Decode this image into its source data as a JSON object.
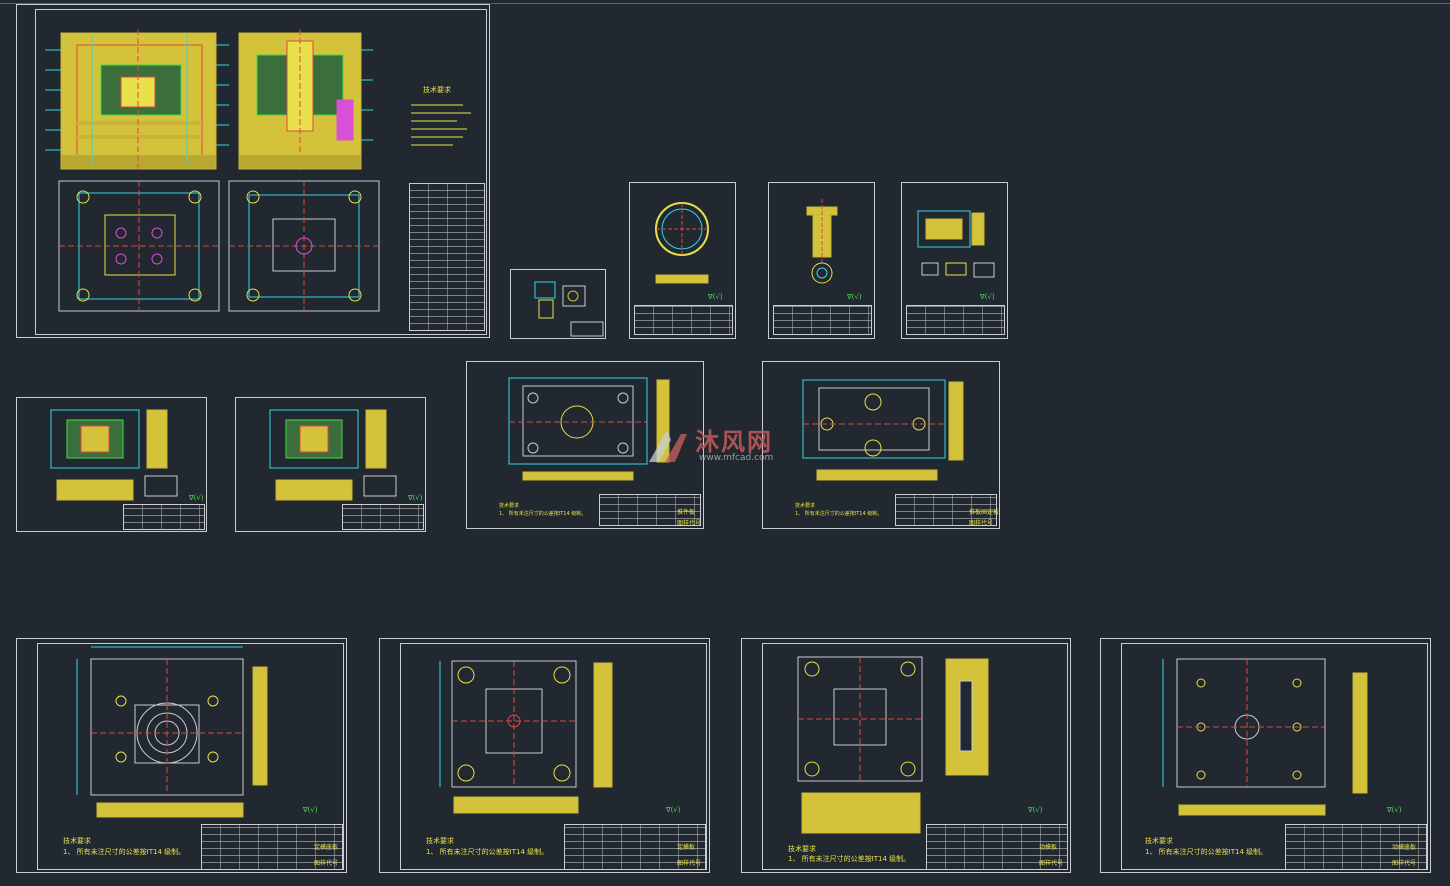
{
  "watermark": {
    "name_cn": "沐风网",
    "url": "www.mfcad.com"
  },
  "assembly_notes_title": "技术要求",
  "plate_notes": {
    "title": "技术要求",
    "line1": "1、 所有未注尺寸的公差按IT14 级制。"
  },
  "title_blocks": {
    "plate_a": {
      "name": "定模座板",
      "code": "图样代号"
    },
    "plate_b": {
      "name": "定模板",
      "code": "图样代号"
    },
    "plate_c": {
      "name": "动模板",
      "code": "图样代号"
    },
    "plate_d": {
      "name": "动模座板",
      "code": "图样代号"
    },
    "mid_a": {
      "name": "推件板",
      "code": "图样代号"
    },
    "mid_b": {
      "name": "推板固定板",
      "code": "图样代号"
    }
  },
  "roughness_symbol": "∇(√)",
  "colors": {
    "background": "#212830",
    "frame": "#c9cdd2",
    "plate_fill": "#d4c23a",
    "hatch": "#c9b53a",
    "cyan": "#32d6e6",
    "red": "#e04646",
    "green": "#3fdc4a",
    "magenta": "#d84fd8"
  }
}
